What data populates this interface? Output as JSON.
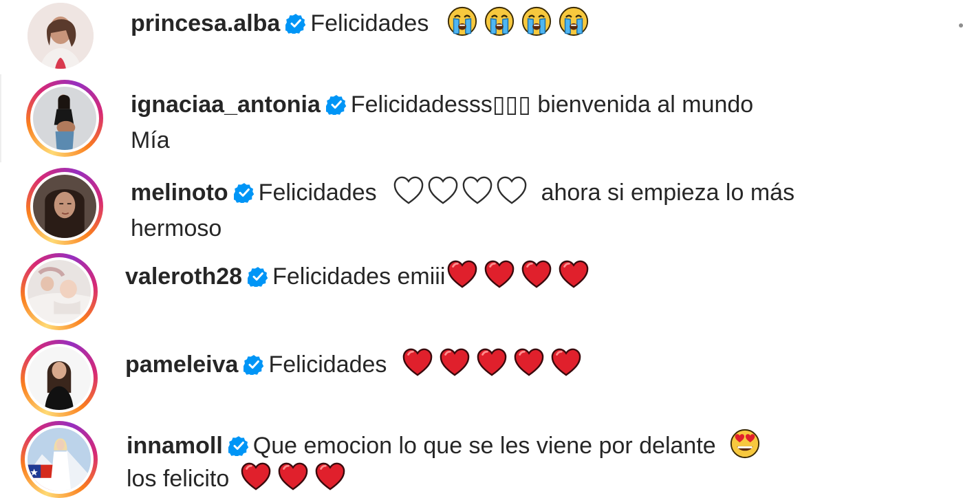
{
  "comments": [
    {
      "username": "princesa.alba",
      "text": "Felicidades",
      "emojis": [
        "crying-face",
        "crying-face",
        "crying-face",
        "crying-face"
      ],
      "text_after": "",
      "continuation": ""
    },
    {
      "username": "ignaciaa_antonia",
      "text": "Felicidadesss▯▯▯ bienvenida al mundo",
      "emojis": [],
      "text_after": "",
      "continuation": "Mía"
    },
    {
      "username": "melinoto",
      "text": "Felicidades",
      "emojis": [
        "white-heart",
        "white-heart",
        "white-heart",
        "white-heart"
      ],
      "text_after": "ahora si empieza lo más",
      "continuation": "hermoso"
    },
    {
      "username": "valeroth28",
      "text": "Felicidades emiii",
      "emojis": [
        "red-heart",
        "red-heart",
        "red-heart",
        "red-heart"
      ],
      "text_after": "",
      "continuation": ""
    },
    {
      "username": "pameleiva",
      "text": "Felicidades",
      "emojis": [
        "red-heart",
        "red-heart",
        "red-heart",
        "red-heart",
        "red-heart"
      ],
      "text_after": "",
      "continuation": ""
    },
    {
      "username": "innamoll",
      "text": "Que emocion lo que se les viene por delante",
      "emojis": [
        "heart-eyes-face"
      ],
      "text_after": "",
      "continuation": "los felicito",
      "continuation_emojis": [
        "red-heart",
        "red-heart",
        "red-heart"
      ]
    }
  ],
  "colors": {
    "verified_badge": "#0095f6",
    "text": "#262626",
    "story_ring_start": "#feda75",
    "story_ring_mid": "#d62976",
    "red_heart": "#e0202c"
  }
}
